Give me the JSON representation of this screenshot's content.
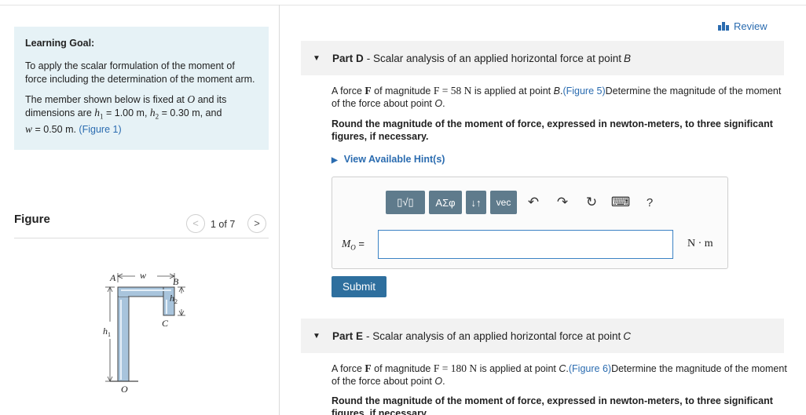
{
  "learning_goal": {
    "title": "Learning Goal:",
    "para1": "To apply the scalar formulation of the moment of force including the determination of the moment arm.",
    "para2_a": "The member shown below is fixed at ",
    "para2_O": "O",
    "para2_b": " and its dimensions are ",
    "h1_sym": "h",
    "h1_sub": "1",
    "h1_val": " = 1.00 m, ",
    "h2_sym": "h",
    "h2_sub": "2",
    "h2_val": " = 0.30 m, and",
    "w_sym": "w",
    "w_val": " = 0.50 m. ",
    "fig_link": "(Figure 1)"
  },
  "figure": {
    "label": "Figure",
    "pager": "1 of 7",
    "prev": "<",
    "next": ">",
    "lbl_A": "A",
    "lbl_B": "B",
    "lbl_C": "C",
    "lbl_O": "O",
    "lbl_w": "w",
    "lbl_h1": "h",
    "lbl_h1_sub": "1",
    "lbl_h2": "h",
    "lbl_h2_sub": "2"
  },
  "review": {
    "label": "Review"
  },
  "part_d": {
    "part": "Part D",
    "title": " - Scalar analysis of an applied horizontal force at point ",
    "point": "B",
    "text_a": "A force ",
    "F": "F",
    "text_b": " of magnitude ",
    "F_eq": "F = 58 N",
    "text_c": " is applied at point ",
    "text_point": "B",
    "text_d": ".",
    "fig_link": "(Figure 5)",
    "text_e": "Determine the magnitude of the moment of the force about point ",
    "text_O": "O",
    "text_f": ".",
    "round": "Round the magnitude of the moment of force, expressed in newton-meters, to three significant figures, if necessary.",
    "hint": "View Available Hint(s)",
    "answer": {
      "label_M": "M",
      "label_sub": "O",
      "label_eq": " =",
      "value": "",
      "unit": "N · m"
    },
    "submit": "Submit"
  },
  "toolbar": {
    "templates": "▯√▯",
    "greek": "ΑΣφ",
    "arrows": "↓↑",
    "vec": "vec",
    "undo": "↶",
    "redo": "↷",
    "reset": "↻",
    "keyboard": "⌨",
    "help": "?"
  },
  "part_e": {
    "part": "Part E",
    "title": " - Scalar analysis of an applied horizontal force at point ",
    "point": "C",
    "text_a": "A force ",
    "F": "F",
    "text_b": " of magnitude ",
    "F_eq": "F = 180 N",
    "text_c": " is applied at point ",
    "text_point": "C",
    "text_d": ".",
    "fig_link": "(Figure 6)",
    "text_e": "Determine the magnitude of the moment of the force about point ",
    "text_O": "O",
    "text_f": ".",
    "round": "Round the magnitude of the moment of force, expressed in newton-meters, to three significant figures, if necessary."
  }
}
